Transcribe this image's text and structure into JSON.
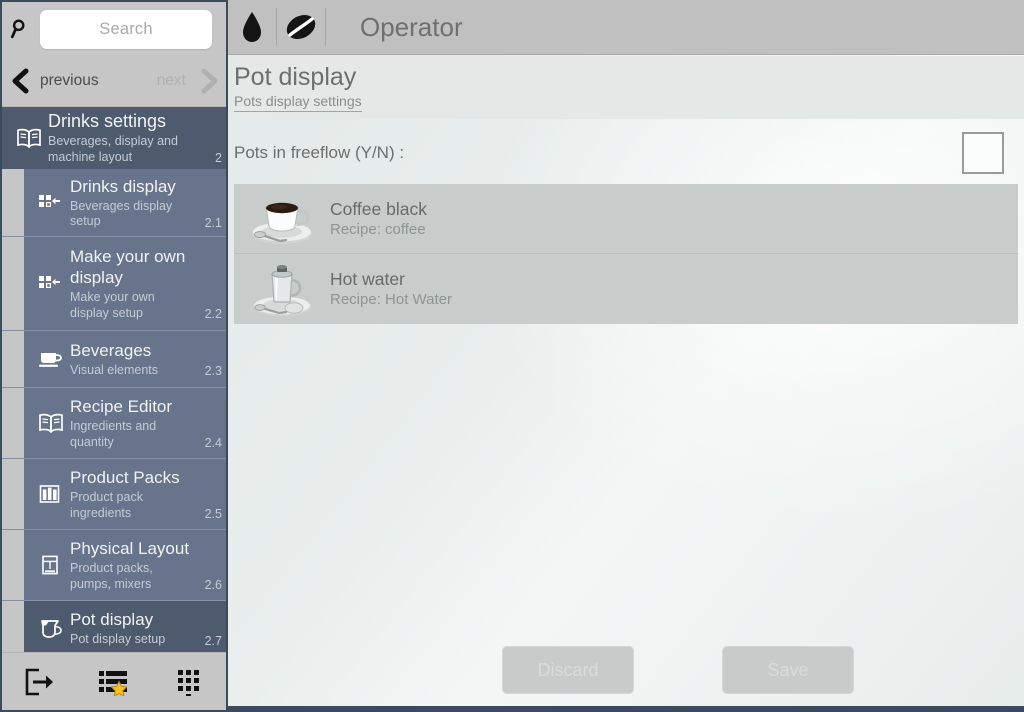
{
  "sidebar": {
    "search": {
      "icon": "search-icon",
      "placeholder": "Search"
    },
    "nav": {
      "prev_label": "previous",
      "next_label": "next",
      "prev_icon": "chevron-left-icon",
      "next_icon": "chevron-right-icon"
    },
    "group": {
      "icon": "book-icon",
      "title": "Drinks settings",
      "subtitle": "Beverages, display and machine layout",
      "number": "2"
    },
    "items": [
      {
        "icon": "grid-arrow-icon",
        "title": "Drinks display",
        "subtitle": "Beverages display setup",
        "number": "2.1",
        "selected": false
      },
      {
        "icon": "grid-arrow-icon",
        "title": "Make your own display",
        "subtitle": "Make your own display setup",
        "number": "2.2",
        "selected": false
      },
      {
        "icon": "cup-icon",
        "title": "Beverages",
        "subtitle": "Visual elements",
        "number": "2.3",
        "selected": false
      },
      {
        "icon": "book-icon",
        "title": "Recipe Editor",
        "subtitle": "Ingredients and quantity",
        "number": "2.4",
        "selected": false
      },
      {
        "icon": "product-pack-icon",
        "title": "Product Packs",
        "subtitle": "Product pack ingredients",
        "number": "2.5",
        "selected": false
      },
      {
        "icon": "machine-icon",
        "title": "Physical Layout",
        "subtitle": "Product packs, pumps, mixers",
        "number": "2.6",
        "selected": false
      },
      {
        "icon": "coffee-pot-icon",
        "title": "Pot display",
        "subtitle": "Pot display setup",
        "number": "2.7",
        "selected": true
      }
    ],
    "toolbar": [
      {
        "icon": "exit-icon",
        "label": "Exit"
      },
      {
        "icon": "list-star-icon",
        "label": "Favourites"
      },
      {
        "icon": "keypad-icon",
        "label": "Keypad"
      }
    ]
  },
  "header": {
    "water_icon": "water-drop-icon",
    "bean_icon": "coffee-bean-icon",
    "title": "Operator"
  },
  "page": {
    "title": "Pot display",
    "subtitle": "Pots display settings"
  },
  "freeflow": {
    "label": "Pots in freeflow (Y/N) :",
    "checked": false
  },
  "pots": [
    {
      "icon": "coffee-cup-image",
      "name": "Coffee black",
      "recipe": "Recipe: coffee"
    },
    {
      "icon": "hot-water-glass-image",
      "name": "Hot water",
      "recipe": "Recipe: Hot Water"
    }
  ],
  "actions": {
    "discard_label": "Discard",
    "save_label": "Save"
  },
  "colors": {
    "sidebar_bg": "#c6c6c6",
    "menu_item": "#67748c",
    "menu_selected": "#4e5b6e",
    "border_dark": "#3c4a5e",
    "topbar": "#c0c0c0",
    "main_bg": "#e9eeec",
    "list_bg": "#c8ccca",
    "title_text": "#6e6e6e"
  }
}
